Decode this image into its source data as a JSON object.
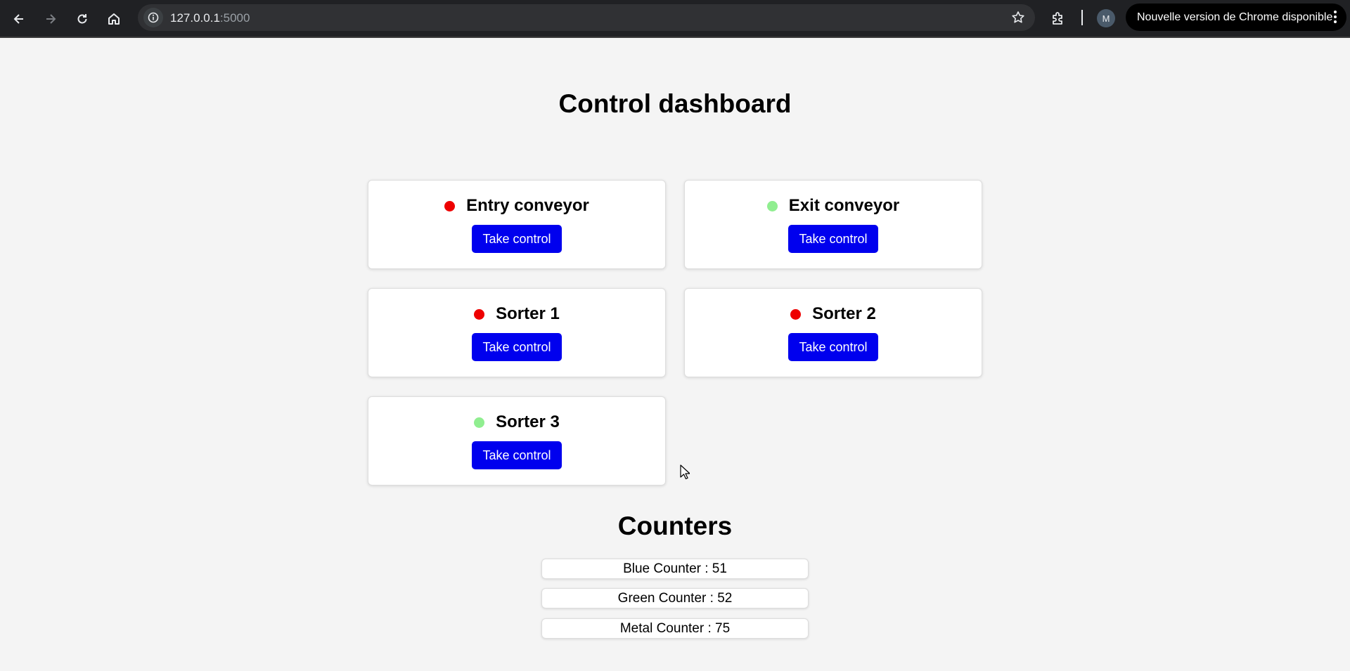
{
  "browser": {
    "url_host": "127.0.0.1",
    "url_port": ":5000",
    "avatar_letter": "M",
    "update_label": "Nouvelle version de Chrome disponible"
  },
  "page": {
    "title": "Control dashboard",
    "cards": [
      {
        "name": "Entry conveyor",
        "status": "red",
        "status_color": "#ee0000",
        "button_label": "Take control"
      },
      {
        "name": "Exit conveyor",
        "status": "green",
        "status_color": "#90ee90",
        "button_label": "Take control"
      },
      {
        "name": "Sorter 1",
        "status": "red",
        "status_color": "#ee0000",
        "button_label": "Take control"
      },
      {
        "name": "Sorter 2",
        "status": "red",
        "status_color": "#ee0000",
        "button_label": "Take control"
      },
      {
        "name": "Sorter 3",
        "status": "green",
        "status_color": "#90ee90",
        "button_label": "Take control"
      }
    ],
    "counters_title": "Counters",
    "counters": [
      {
        "label": "Blue Counter : 51"
      },
      {
        "label": "Green Counter : 52"
      },
      {
        "label": "Metal Counter : 75"
      }
    ]
  },
  "colors": {
    "button_bg": "#0000ee",
    "page_bg": "#f4f4f4",
    "chrome_bg": "#202124"
  }
}
